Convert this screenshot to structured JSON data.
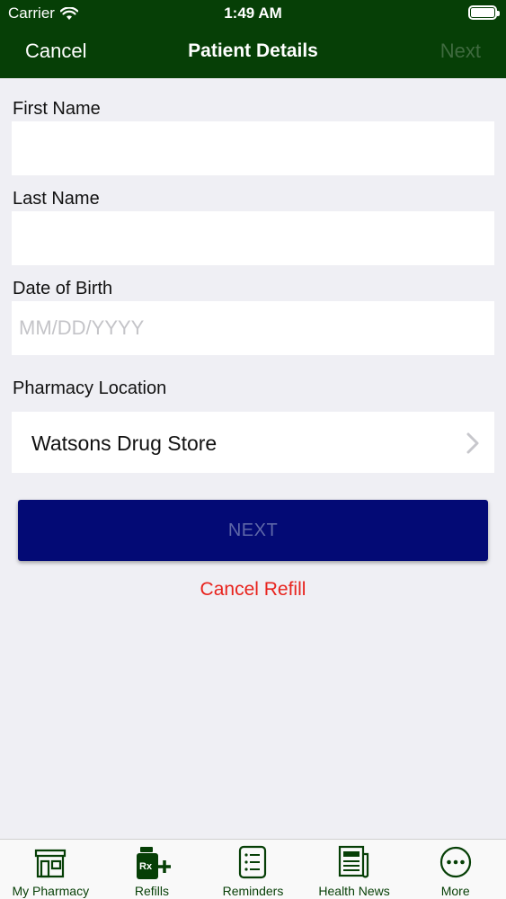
{
  "status_bar": {
    "carrier": "Carrier",
    "time": "1:49 AM"
  },
  "nav": {
    "cancel": "Cancel",
    "title": "Patient Details",
    "next": "Next"
  },
  "form": {
    "first_name": {
      "label": "First Name",
      "value": "",
      "placeholder": ""
    },
    "last_name": {
      "label": "Last Name",
      "value": "",
      "placeholder": ""
    },
    "dob": {
      "label": "Date of Birth",
      "value": "",
      "placeholder": "MM/DD/YYYY"
    },
    "pharmacy": {
      "label": "Pharmacy Location",
      "value": "Watsons Drug Store"
    }
  },
  "actions": {
    "next": "NEXT",
    "cancel_refill": "Cancel Refill"
  },
  "tabs": [
    {
      "label": "My Pharmacy",
      "icon": "pharmacy-icon"
    },
    {
      "label": "Refills",
      "icon": "rx-refill-icon",
      "badge_text": "Rx"
    },
    {
      "label": "Reminders",
      "icon": "reminders-icon"
    },
    {
      "label": "Health News",
      "icon": "health-news-icon"
    },
    {
      "label": "More",
      "icon": "more-icon"
    }
  ],
  "colors": {
    "brand_green": "#063f06",
    "next_button": "#030a75",
    "cancel_red": "#e8231d",
    "background": "#efeff4"
  }
}
